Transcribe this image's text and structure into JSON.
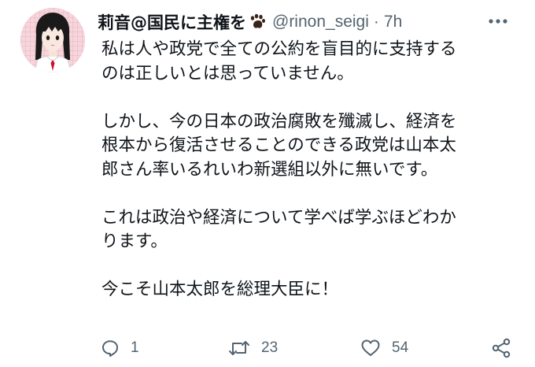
{
  "tweet": {
    "display_name": "莉音@国民に主権を",
    "display_name_icon": "paw-icon",
    "handle": "@rinon_seigi",
    "separator": "·",
    "time": "7h",
    "avatar_icon": "anime-girl-avatar",
    "more_icon": "more-dots-icon",
    "paragraphs": [
      [
        "私は人や政党で全ての公約を盲目的に支持する",
        "のは正しいとは思っていません。"
      ],
      [
        "しかし、今の日本の政治腐敗を殲滅し、経済を",
        "根本から復活させることのできる政党は山本太",
        "郎さん率いるれいわ新選組以外に無いです。"
      ],
      [
        "これは政治や経済について学べば学ぶほどわか",
        "ります。"
      ],
      [
        "今こそ山本太郎を総理大臣に！"
      ]
    ]
  },
  "actions": {
    "reply": {
      "icon": "reply-icon",
      "count": "1"
    },
    "retweet": {
      "icon": "retweet-icon",
      "count": "23"
    },
    "like": {
      "icon": "heart-icon",
      "count": "54"
    },
    "share": {
      "icon": "share-icon"
    }
  },
  "colors": {
    "text": "#0f1419",
    "secondary": "#536471",
    "avatar_bg": "#f3d0d6"
  }
}
